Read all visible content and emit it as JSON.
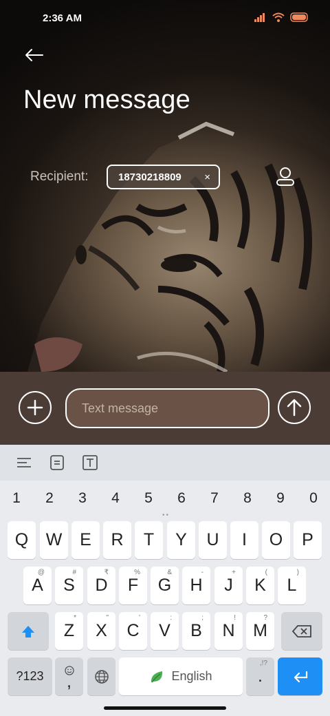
{
  "status_bar": {
    "time": "2:36 AM"
  },
  "header": {
    "title": "New message",
    "back_icon": "arrow-left-icon"
  },
  "recipient": {
    "label": "Recipient:",
    "chip_number": "18730218809",
    "chip_close": "×",
    "contact_icon": "person-icon"
  },
  "compose": {
    "placeholder": "Text message",
    "value": "",
    "add_icon": "plus-icon",
    "send_icon": "arrow-up-icon"
  },
  "keyboard": {
    "toolbar_icons": [
      "menu-lines-icon",
      "clipboard-icon",
      "text-format-icon"
    ],
    "numbers": [
      "1",
      "2",
      "3",
      "4",
      "5",
      "6",
      "7",
      "8",
      "9",
      "0"
    ],
    "row1": [
      "Q",
      "W",
      "E",
      "R",
      "T",
      "Y",
      "U",
      "I",
      "O",
      "P"
    ],
    "row2": [
      {
        "key": "A",
        "hint": "@"
      },
      {
        "key": "S",
        "hint": "#"
      },
      {
        "key": "D",
        "hint": "₹"
      },
      {
        "key": "F",
        "hint": "%"
      },
      {
        "key": "G",
        "hint": "&"
      },
      {
        "key": "H",
        "hint": "-"
      },
      {
        "key": "J",
        "hint": "+"
      },
      {
        "key": "K",
        "hint": "("
      },
      {
        "key": "L",
        "hint": ")"
      }
    ],
    "row3": [
      {
        "key": "Z",
        "hint": "*"
      },
      {
        "key": "X",
        "hint": "\""
      },
      {
        "key": "C",
        "hint": "'"
      },
      {
        "key": "V",
        "hint": ":"
      },
      {
        "key": "B",
        "hint": ";"
      },
      {
        "key": "N",
        "hint": "!"
      },
      {
        "key": "M",
        "hint": "?"
      }
    ],
    "sym_label": "?123",
    "comma_label": ",",
    "space_label": "English",
    "period_label": ".",
    "period_hint": ",!?"
  }
}
